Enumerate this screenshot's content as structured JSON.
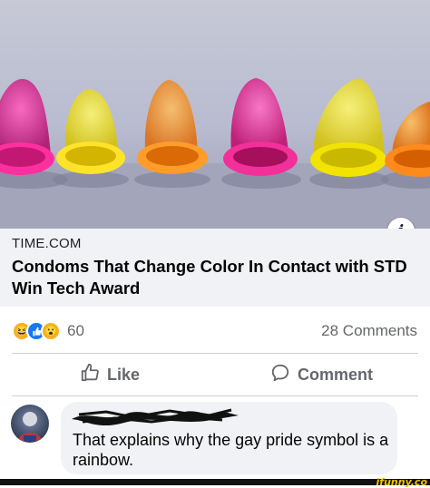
{
  "post": {
    "link_preview": {
      "domain": "TIME.COM",
      "title": "Condoms That Change Color In Contact with STD Win Tech Award",
      "image_description_icon": "info-icon"
    },
    "reactions": {
      "icons": [
        "haha-icon",
        "like-icon",
        "wow-icon"
      ],
      "count": "60"
    },
    "comments_count": "28 Comments",
    "actions": {
      "like_label": "Like",
      "comment_label": "Comment"
    }
  },
  "comment": {
    "author_redacted": true,
    "text": "That explains why the gay pride symbol is a rainbow."
  },
  "watermark": "ifunny.co",
  "colors": {
    "link_box": "#f0f2f5",
    "secondary_text": "#65676b",
    "like_blue": "#1877f2",
    "reaction_yellow": "#f7b125"
  }
}
